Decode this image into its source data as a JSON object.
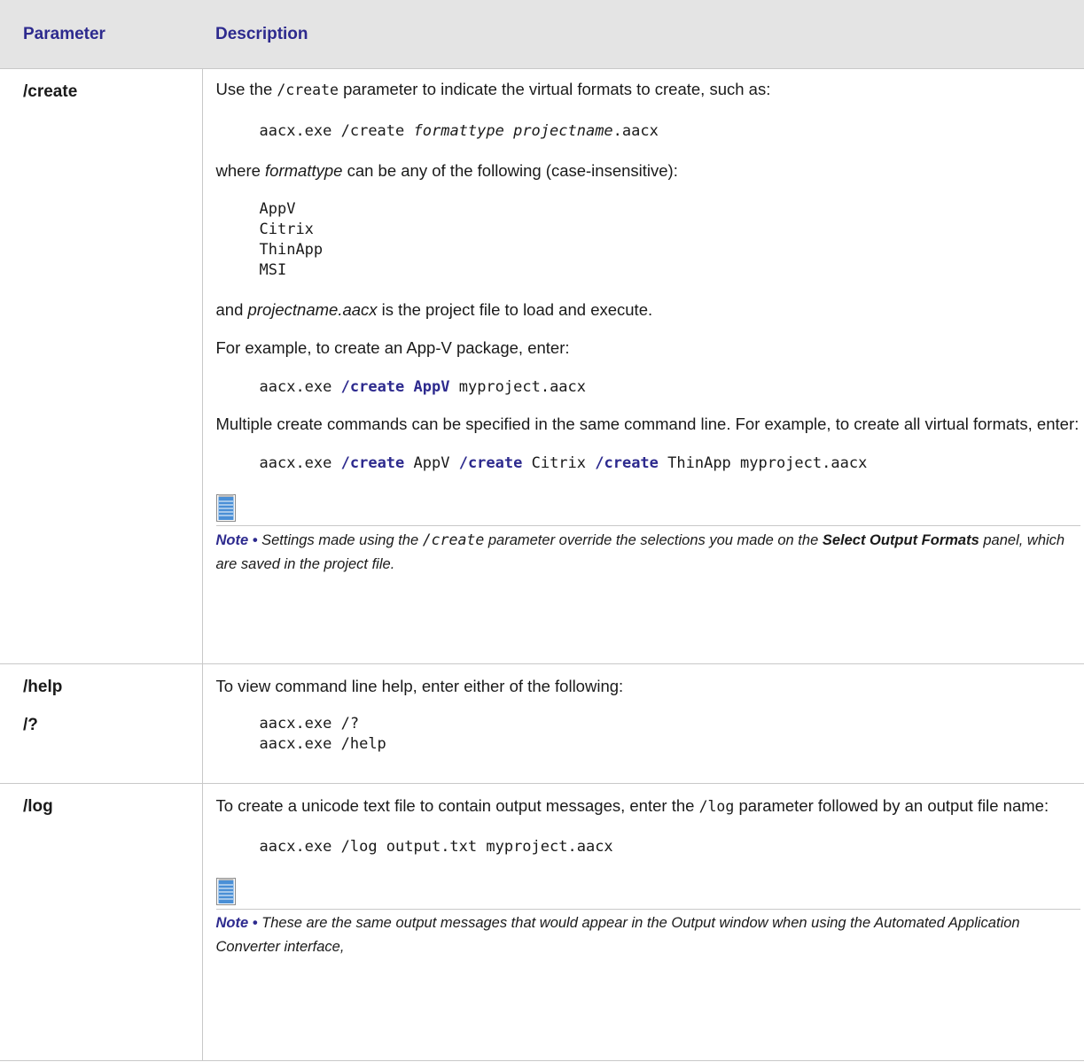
{
  "header": {
    "param": "Parameter",
    "desc": "Description"
  },
  "create": {
    "param": "/create",
    "intro_pre": "Use the ",
    "intro_code": "/create",
    "intro_post": " parameter to indicate the virtual formats to create, such as:",
    "code1_a": "aacx.exe /create ",
    "code1_b": "formattype projectname",
    "code1_c": ".aacx",
    "where_pre": "where ",
    "where_em": "formattype",
    "where_post": " can be any of the following (case-insensitive):",
    "formats": [
      "AppV",
      "Citrix",
      "ThinApp",
      "MSI"
    ],
    "and_pre": "and ",
    "and_em": "projectname.aacx",
    "and_post": " is the project file to load and execute.",
    "example_text": "For example, to create an App-V package, enter:",
    "ex_a": "aacx.exe ",
    "ex_kw1": "/create",
    "ex_kw2": "AppV",
    "ex_c": " myproject.aacx",
    "multi_text": "Multiple create commands can be specified in the same command line. For example, to create all virtual formats, enter:",
    "m_a": "aacx.exe ",
    "m_kw": "/create",
    "m_1": " AppV ",
    "m_2": " Citrix ",
    "m_3": " ThinApp myproject.aacx",
    "note_label": "Note •",
    "note_a": " Settings made using the ",
    "note_code": "/create",
    "note_b": " parameter override the selections you made on the ",
    "note_bold": "Select Output Formats",
    "note_c": " panel, which are saved in the project file."
  },
  "help": {
    "param1": "/help",
    "param2": "/?",
    "intro": "To view command line help, enter either of the following:",
    "code_lines": [
      "aacx.exe /?",
      "aacx.exe /help"
    ]
  },
  "log": {
    "param": "/log",
    "intro_pre": "To create a unicode text file to contain output messages, enter the ",
    "intro_code": "/log",
    "intro_post": " parameter followed by an output file name:",
    "code": "aacx.exe /log output.txt myproject.aacx",
    "note_label": "Note •",
    "note_text": "  These are the same output messages that would appear in the Output window when using the Automated Application Converter interface,"
  },
  "icons": {
    "note": "note-pad-icon"
  },
  "colors": {
    "accent": "#2d2a8e",
    "header_bg": "#e4e4e4",
    "rule": "#c8c8c8"
  }
}
